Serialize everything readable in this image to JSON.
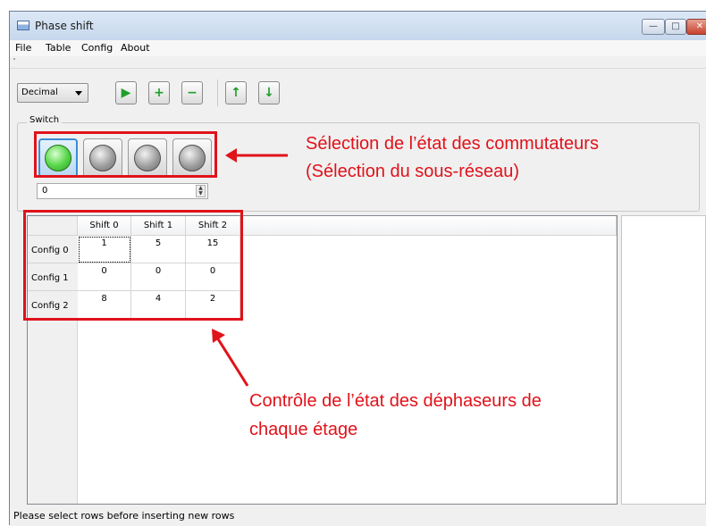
{
  "window": {
    "title": "Phase shift",
    "controls": {
      "minimize_glyph": "—",
      "maximize_glyph": "□",
      "close_glyph": "✕"
    }
  },
  "menubar": {
    "items": [
      "File",
      "Table",
      "Config",
      "About"
    ]
  },
  "toolbar": {
    "format_select": {
      "selected": "Decimal"
    },
    "buttons": [
      {
        "icon": "play-icon",
        "glyph": "▶"
      },
      {
        "icon": "plus-icon",
        "glyph": "+"
      },
      {
        "icon": "minus-icon",
        "glyph": "−"
      },
      {
        "icon": "arrow-up-icon",
        "glyph": "↑"
      },
      {
        "icon": "arrow-down-icon",
        "glyph": "↓"
      }
    ]
  },
  "switch_group": {
    "title": "Switch",
    "switches": [
      {
        "state": "on"
      },
      {
        "state": "off"
      },
      {
        "state": "off"
      },
      {
        "state": "off"
      }
    ],
    "spinbox_value": "0"
  },
  "table": {
    "columns": [
      "Shift 0",
      "Shift 1",
      "Shift 2"
    ],
    "rows": [
      {
        "header": "Config 0",
        "cells": [
          "1",
          "5",
          "15"
        ]
      },
      {
        "header": "Config 1",
        "cells": [
          "0",
          "0",
          "0"
        ]
      },
      {
        "header": "Config 2",
        "cells": [
          "8",
          "4",
          "2"
        ]
      }
    ]
  },
  "status": {
    "message": "Please select rows before inserting new rows"
  },
  "annotations": {
    "switch_note_line1": "Sélection de l’état des commutateurs",
    "switch_note_line2": "(Sélection du sous-réseau)",
    "table_note_line1": "Contrôle de l’état des déphaseurs de",
    "table_note_line2": "chaque étage"
  },
  "colors": {
    "annotation": "#e0121a",
    "led_on": "#58d64a",
    "led_off": "#9a9a9a",
    "toolbar_icon": "#1e9e2a"
  }
}
